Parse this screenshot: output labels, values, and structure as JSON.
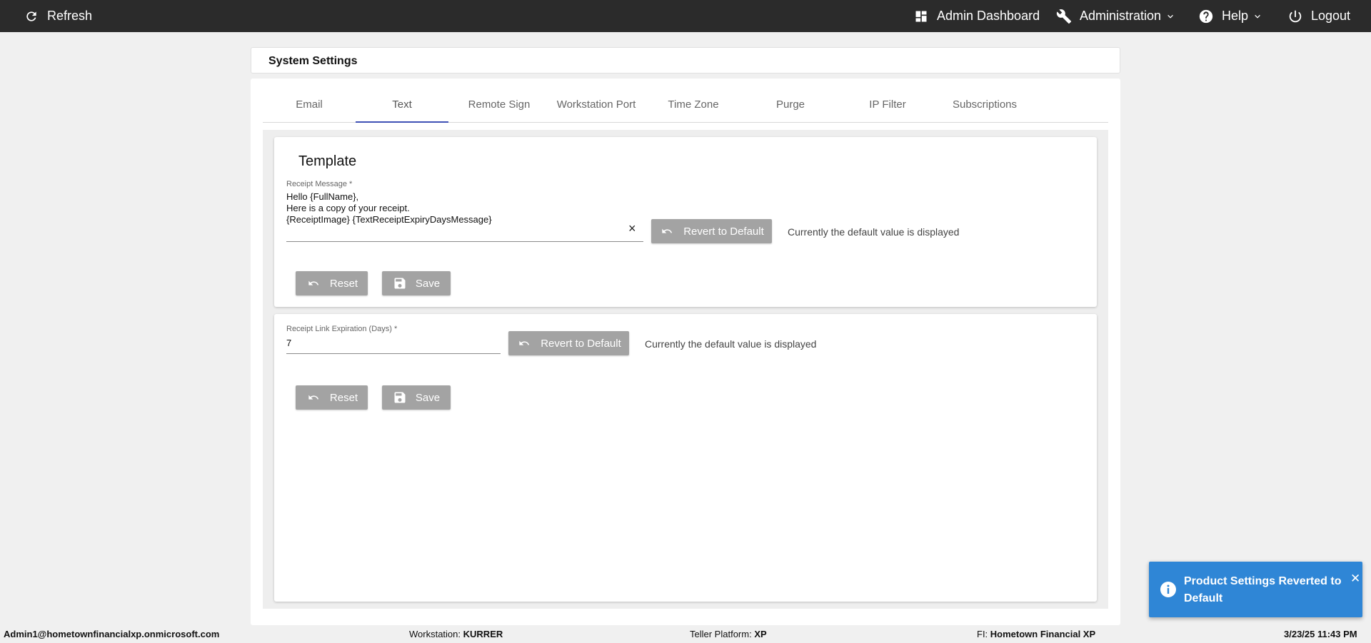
{
  "nav": {
    "refresh_label": "Refresh",
    "admin_dashboard_label": "Admin Dashboard",
    "administration_label": "Administration",
    "help_label": "Help",
    "logout_label": "Logout"
  },
  "page": {
    "title": "System Settings"
  },
  "tabs": [
    "Email",
    "Text",
    "Remote Sign",
    "Workstation Port",
    "Time Zone",
    "Purge",
    "IP Filter",
    "Subscriptions"
  ],
  "active_tab": "Text",
  "template_panel": {
    "title": "Template",
    "field_label": "Receipt Message *",
    "field_value": "Hello {FullName},\nHere is a copy of your receipt.\n{ReceiptImage} {TextReceiptExpiryDaysMessage}",
    "clear_icon": "×",
    "revert_label": "Revert to Default",
    "status_text": "Currently the default value is displayed",
    "reset_label": "Reset",
    "save_label": "Save"
  },
  "expiration_panel": {
    "field_label": "Receipt Link Expiration (Days) *",
    "field_value": "7",
    "revert_label": "Revert to Default",
    "status_text": "Currently the default value is displayed",
    "reset_label": "Reset",
    "save_label": "Save"
  },
  "footer": {
    "user": "Admin1@hometownfinancialxp.onmicrosoft.com",
    "workstation_label": "Workstation:",
    "workstation_value": "KURRER",
    "platform_label": "Teller Platform:",
    "platform_value": "XP",
    "fi_label": "FI:",
    "fi_value": "Hometown Financial XP",
    "datetime": "3/23/25 11:43 PM"
  },
  "toast": {
    "message": "Product Settings Reverted to Default",
    "close_icon": "✕"
  },
  "colors": {
    "topbar": "#2b2b2b",
    "tab_indicator": "#3f51b5",
    "button": "#a3a3a3",
    "toast": "#2f86d6"
  }
}
